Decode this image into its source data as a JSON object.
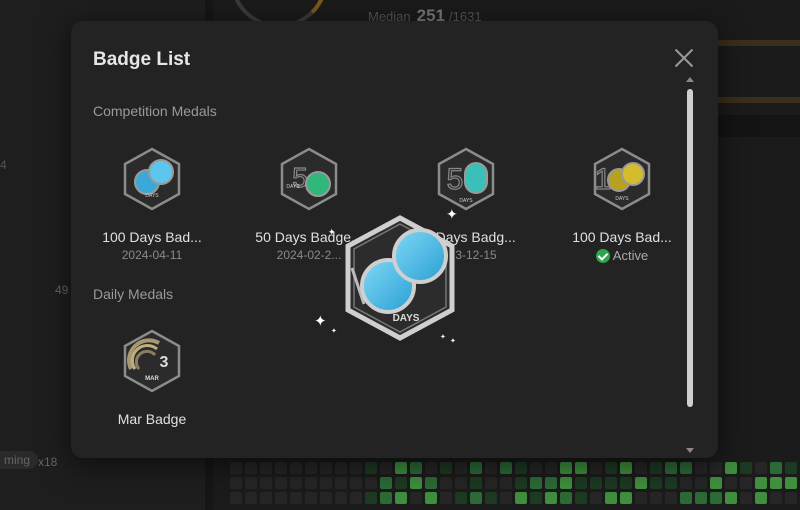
{
  "background": {
    "median_label": "Median",
    "median_value": "251",
    "median_total": "/1631",
    "left_number_a": "4",
    "left_number_b": "49",
    "chip_label": "ming",
    "chip_multiplier": "x18"
  },
  "modal": {
    "title": "Badge List",
    "sections": [
      {
        "title": "Competition Medals",
        "badges": [
          {
            "name": "100 Days Bad...",
            "date": "2024-04-11",
            "icon": "100-days-blue-badge-icon"
          },
          {
            "name": "50 Days Badge...",
            "date": "2024-02-2...",
            "icon": "50-days-green-badge-icon"
          },
          {
            "name": "50 Days Badg...",
            "date": "2023-12-15",
            "icon": "50-days-teal-badge-icon"
          },
          {
            "name": "100 Days Bad...",
            "status": "Active",
            "icon": "100-days-gold-badge-icon"
          }
        ]
      },
      {
        "title": "Daily Medals",
        "badges": [
          {
            "name": "Mar Badge",
            "icon": "mar-3-daily-badge-icon",
            "day": "3",
            "month": "MAR"
          }
        ]
      }
    ],
    "badge_caption": "DAYS"
  },
  "featured_badge": {
    "icon": "100-days-featured-badge-icon",
    "caption": "DAYS"
  },
  "colors": {
    "modal_bg": "#232323",
    "blue": "#4fc3ea",
    "green": "#2fb87a",
    "teal": "#3ac0b8",
    "gold": "#c9b22a",
    "active": "#2da44e"
  }
}
